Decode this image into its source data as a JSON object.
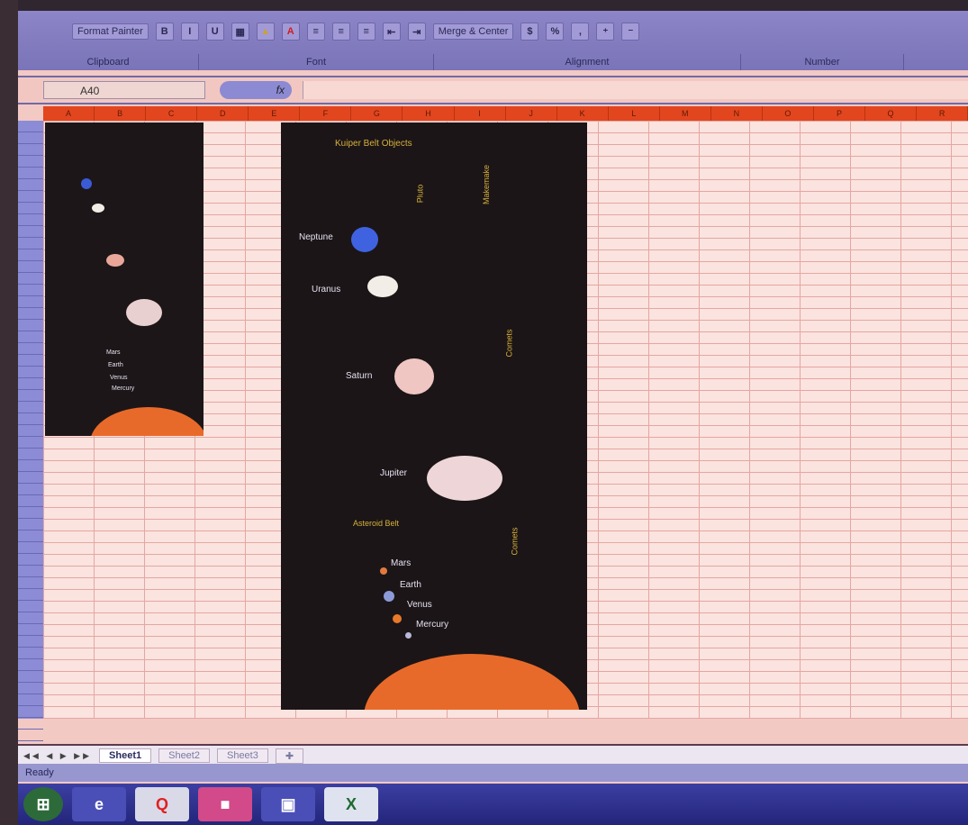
{
  "ribbon": {
    "format_painter_label": "Format Painter",
    "bold": "B",
    "italic": "I",
    "underline": "U",
    "merge_center_label": "Merge & Center",
    "groups": [
      "Clipboard",
      "Font",
      "Alignment",
      "Number"
    ]
  },
  "formula_bar": {
    "name_box": "A40",
    "fx": "fx"
  },
  "columns": [
    "A",
    "B",
    "C",
    "D",
    "E",
    "F",
    "G",
    "H",
    "I",
    "J",
    "K",
    "L",
    "M",
    "N",
    "O",
    "P",
    "Q",
    "R"
  ],
  "image_small": {
    "labels": [
      "Mars",
      "Earth",
      "Venus",
      "Mercury"
    ]
  },
  "image_big": {
    "title": "Kuiper Belt Objects",
    "vertical_labels": [
      "Pluto",
      "Makemake",
      "Comets",
      "Comets"
    ],
    "planet_labels": [
      "Neptune",
      "Uranus",
      "Saturn",
      "Jupiter",
      "Asteroid Belt",
      "Mars",
      "Earth",
      "Venus",
      "Mercury"
    ]
  },
  "sheets": {
    "tabs": [
      "Sheet1",
      "Sheet2",
      "Sheet3"
    ],
    "active": "Sheet1"
  },
  "status": {
    "text": "Ready"
  },
  "taskbar": {
    "apps": [
      "start",
      "ie",
      "q",
      "app-pink",
      "app-window",
      "app-excel"
    ]
  },
  "colors": {
    "ribbon": "#8c86c8",
    "column_header": "#e2461f",
    "sheet_bg": "#fbe3df",
    "image_bg": "#1b1517",
    "sun": "#e86a2a"
  }
}
